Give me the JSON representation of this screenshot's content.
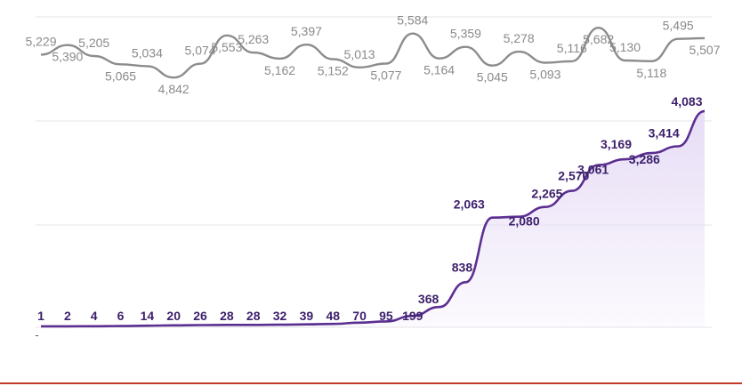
{
  "chart_data": {
    "type": "line",
    "title": "",
    "xlabel": "",
    "ylabel": "",
    "grid": true,
    "legend": "none",
    "series": [
      {
        "values": [
          5229,
          5390,
          5205,
          5065,
          5034,
          4842,
          5074,
          5553,
          5263,
          5162,
          5397,
          5152,
          5013,
          5077,
          5584,
          5164,
          5359,
          5045,
          5278,
          5093,
          5116,
          5682,
          5130,
          5118,
          5495,
          5507
        ],
        "labels": [
          "5,229",
          "5,390",
          "5,205",
          "5,065",
          "5,034",
          "4,842",
          "5,074",
          "5,553",
          "5,263",
          "5,162",
          "5,397",
          "5,152",
          "5,013",
          "5,077",
          "5,584",
          "5,164",
          "5,359",
          "5,045",
          "5,278",
          "5,093",
          "5,116",
          "5,682",
          "5,130",
          "5,118",
          "5,495",
          "5,507"
        ],
        "color": "#8c8c8c"
      },
      {
        "values": [
          1,
          2,
          4,
          6,
          14,
          20,
          26,
          28,
          28,
          32,
          39,
          48,
          70,
          95,
          199,
          368,
          838,
          2063,
          2080,
          2265,
          2570,
          3061,
          3169,
          3286,
          3414,
          4083
        ],
        "labels": [
          "1",
          "2",
          "4",
          "6",
          "14",
          "20",
          "26",
          "28",
          "28",
          "32",
          "39",
          "48",
          "70",
          "95",
          "199",
          "368",
          "838",
          "2,063",
          "2,080",
          "2,265",
          "2,570",
          "3,061",
          "3,169",
          "3,286",
          "3,414",
          "4,083"
        ],
        "color": "#5b2e91",
        "fill": "#e7ddf6"
      }
    ]
  }
}
